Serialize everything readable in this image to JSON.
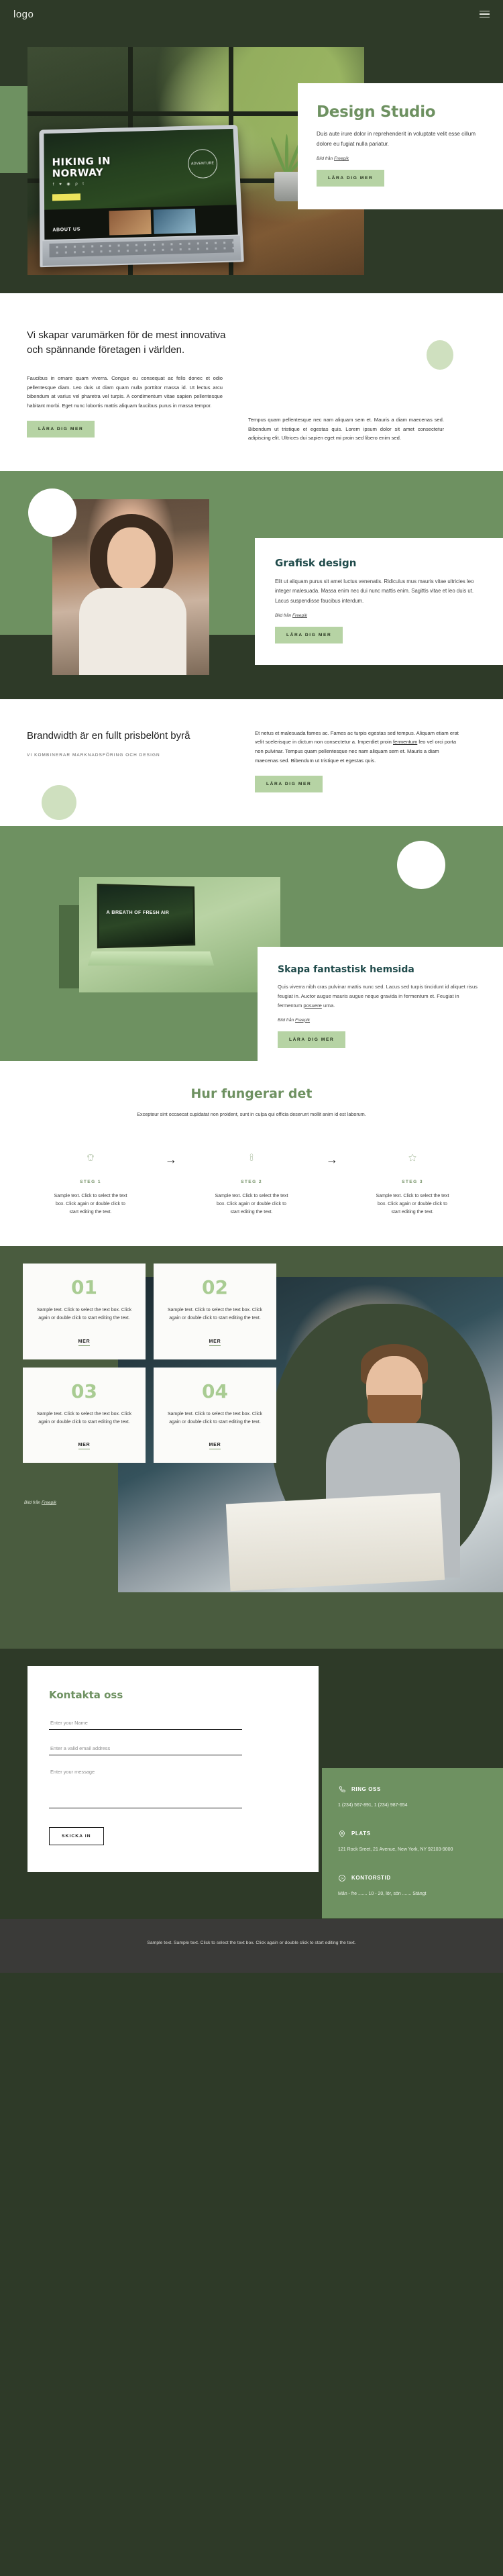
{
  "header": {
    "logo": "logo",
    "menu_icon": "hamburger-icon"
  },
  "hero": {
    "title": "Design Studio",
    "body": "Duis aute irure dolor in reprehenderit in voluptate velit esse cillum dolore eu fugiat nulla pariatur.",
    "credit_prefix": "Bild från ",
    "credit_link": "Freepik",
    "cta": "LÄRA DIG MER",
    "laptop_screen": {
      "headline_line1": "HIKING IN",
      "headline_line2": "NORWAY",
      "badge": "ADVENTURE",
      "about": "ABOUT US",
      "socials": "f ♥ ◉ ρ t"
    }
  },
  "intro": {
    "heading": "Vi skapar varumärken för de mest innovativa och spännande företagen i världen.",
    "left_body": "Faucibus in ornare quam viverra. Congue eu consequat ac felis donec et odio pellentesque diam. Leo duis ut diam quam nulla porttitor massa id. Ut lectus arcu bibendum at varius vel pharetra vel turpis. A condimentum vitae sapien pellentesque habitant morbi. Eget nunc lobortis mattis aliquam faucibus purus in massa tempor.",
    "right_body": "Tempus quam pellentesque nec nam aliquam sem et. Mauris a diam maecenas sed. Bibendum ut tristique et egestas quis. Lorem ipsum dolor sit amet consectetur adipiscing elit. Ultrices dui sapien eget mi proin sed libero enim sed.",
    "cta": "LÄRA DIG MER"
  },
  "graphic": {
    "title": "Grafisk design",
    "body": "Elit ut aliquam purus sit amet luctus venenatis. Ridiculus mus mauris vitae ultricies leo integer malesuada. Massa enim nec dui nunc mattis enim. Sagittis vitae et leo duis ut. Lacus suspendisse faucibus interdum.",
    "credit_prefix": "Bild från ",
    "credit_link": "Freepik",
    "cta": "LÄRA DIG MER"
  },
  "brandwidth": {
    "heading": "Brandwidth är en fullt prisbelönt byrå",
    "kicker": "VI KOMBINERAR MARKNADSFÖRING OCH DESIGN",
    "body_part1": "Et netus et malesuada fames ac. Fames ac turpis egestas sed tempus. Aliquam etiam erat velit scelerisque in dictum non consectetur a. Imperdiet proin ",
    "body_link": "fermentum",
    "body_part2": " leo vel orci porta non pulvinar. Tempus quam pellentesque nec nam aliquam sem et. Mauris a diam maecenas sed. Bibendum ut tristique et egestas quis.",
    "cta": "LÄRA DIG MER"
  },
  "website": {
    "title": "Skapa fantastisk hemsida",
    "body_part1": "Quis viverra nibh cras pulvinar mattis nunc sed. Lacus sed turpis tincidunt id aliquet risus feugiat in. Auctor augue mauris augue neque gravida in fermentum et. Feugiat in fermentum ",
    "body_link": "posuere",
    "body_part2": " urna.",
    "credit_prefix": "Bild från ",
    "credit_link": "Freepik",
    "cta": "LÄRA DIG MER",
    "laptop_caption": "A BREATH OF FRESH AIR"
  },
  "steps_section": {
    "title": "Hur fungerar det",
    "lead": "Excepteur sint occaecat cupidatat non proident, sunt in culpa qui officia deserunt mollit anim id est laborum.",
    "steps": [
      {
        "icon": "mobile-phone-icon",
        "label": "STEG 1",
        "text": "Sample text. Click to select the text box. Click again or double click to start editing the text."
      },
      {
        "icon": "stamp-icon",
        "label": "STEG 2",
        "text": "Sample text. Click to select the text box. Click again or double click to start editing the text."
      },
      {
        "icon": "star-icon",
        "label": "STEG 3",
        "text": "Sample text. Click to select the text box. Click again or double click to start editing the text."
      }
    ],
    "arrow": "→"
  },
  "number_cards": {
    "items": [
      {
        "num": "01",
        "text": "Sample text. Click to select the text box. Click again or double click to start editing the text.",
        "more": "MER"
      },
      {
        "num": "02",
        "text": "Sample text. Click to select the text box. Click again or double click to start editing the text.",
        "more": "MER"
      },
      {
        "num": "03",
        "text": "Sample text. Click to select the text box. Click again or double click to start editing the text.",
        "more": "MER"
      },
      {
        "num": "04",
        "text": "Sample text. Click to select the text box. Click again or double click to start editing the text.",
        "more": "MER"
      }
    ],
    "credit_prefix": "Bild från ",
    "credit_link": "Freepik"
  },
  "contact": {
    "title": "Kontakta oss",
    "name_placeholder": "Enter your Name",
    "email_placeholder": "Enter a valid email address",
    "message_placeholder": "Enter your message",
    "submit": "SKICKA IN",
    "info": [
      {
        "icon": "phone-icon",
        "title": "RING OSS",
        "value": "1 (234) 567-891, 1 (234) 987-654"
      },
      {
        "icon": "map-pin-icon",
        "title": "PLATS",
        "value": "121 Rock Sreet, 21 Avenue, New York, NY 92103-9000"
      },
      {
        "icon": "clock-24-icon",
        "title": "KONTORSTID",
        "value": "Mån - fre ....... 10 - 20, lör, sön ....... Stängt"
      }
    ]
  },
  "footer": {
    "text": "Sample text. Sample text. Click to select the text box. Click again or double click to start editing the text."
  },
  "colors": {
    "dark_green": "#2e3a28",
    "mid_green": "#6e9161",
    "light_green": "#b6d3a4",
    "pale_green": "#cfe0bf",
    "teal_heading": "#1f4a4a",
    "number_green": "#a9cc93",
    "footer_bg": "#3a3a38"
  }
}
